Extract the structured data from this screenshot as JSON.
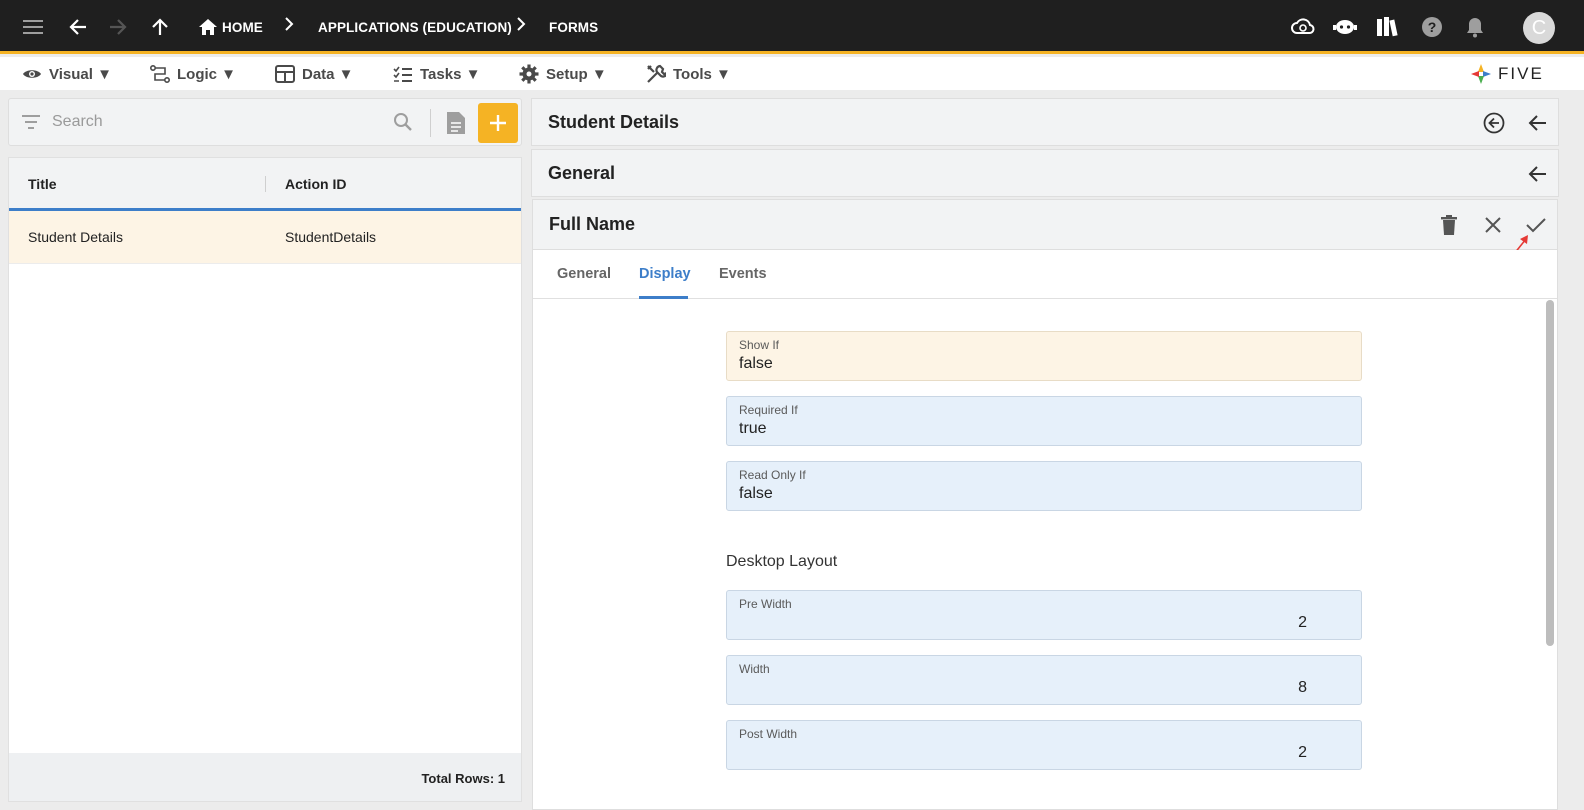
{
  "topbar": {
    "breadcrumbs": [
      "HOME",
      "APPLICATIONS (EDUCATION)",
      "FORMS"
    ],
    "avatar_letter": "C",
    "icons": [
      "menu-icon",
      "back-arrow-icon",
      "forward-arrow-icon",
      "up-arrow-icon",
      "home-icon",
      "cloud-sync-icon",
      "chat-bot-icon",
      "library-icon",
      "help-icon",
      "notifications-icon"
    ]
  },
  "menubar": {
    "items": [
      {
        "label": "Visual ▼",
        "icon": "eye-icon"
      },
      {
        "label": "Logic ▼",
        "icon": "logic-flow-icon"
      },
      {
        "label": "Data ▼",
        "icon": "table-icon"
      },
      {
        "label": "Tasks ▼",
        "icon": "checklist-icon"
      },
      {
        "label": "Setup ▼",
        "icon": "gear-icon"
      },
      {
        "label": "Tools ▼",
        "icon": "tools-icon"
      }
    ],
    "logo_text": "FIVE"
  },
  "left": {
    "search_placeholder": "Search",
    "columns": [
      "Title",
      "Action ID"
    ],
    "rows": [
      {
        "title": "Student Details",
        "action_id": "StudentDetails"
      }
    ],
    "total_rows": "Total Rows: 1"
  },
  "right": {
    "record_title": "Student Details",
    "section_title": "General",
    "form": {
      "title": "Full Name",
      "tabs": [
        "General",
        "Display",
        "Events"
      ],
      "active_tab": "Display",
      "fields": [
        {
          "label": "Show If",
          "value": "false"
        },
        {
          "label": "Required If",
          "value": "true"
        },
        {
          "label": "Read Only If",
          "value": "false"
        }
      ],
      "desktop_layout_heading": "Desktop Layout",
      "layout_fields": [
        {
          "label": "Pre Width",
          "value": "2"
        },
        {
          "label": "Width",
          "value": "8"
        },
        {
          "label": "Post Width",
          "value": "2"
        }
      ]
    }
  },
  "colors": {
    "accent": "#f5b324",
    "primary": "#3d7ec9",
    "topbar": "#1f1f1f",
    "annotation_arrow": "#e53935"
  }
}
